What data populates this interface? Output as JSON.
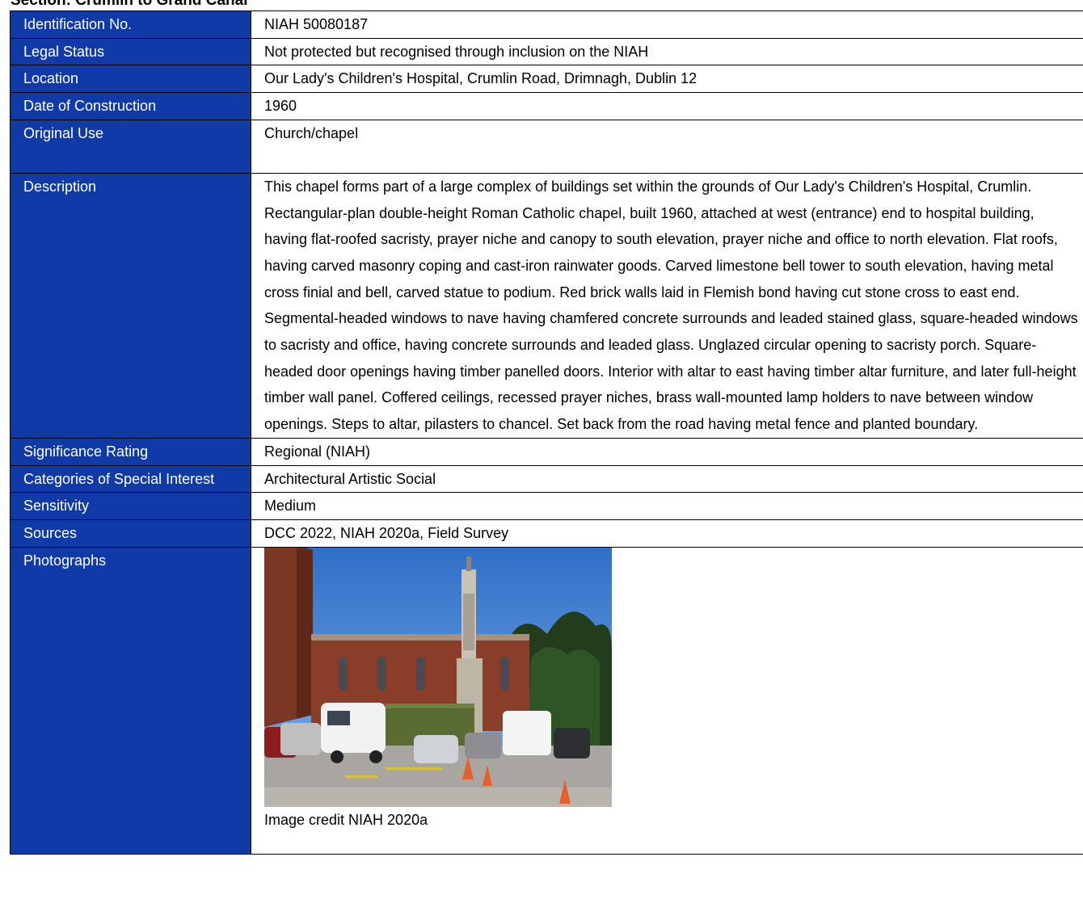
{
  "section": {
    "heading": "Section: Crumlin to Grand Canal"
  },
  "record": {
    "identification_label": "Identification No.",
    "identification_value": "NIAH 50080187",
    "legal_status_label": "Legal Status",
    "legal_status_value": "Not protected but recognised through inclusion on the NIAH",
    "location_label": "Location",
    "location_value": "Our Lady's Children's Hospital, Crumlin Road, Drimnagh, Dublin 12",
    "date_label": "Date of Construction",
    "date_value": "1960",
    "original_use_label": "Original Use",
    "original_use_value": "Church/chapel",
    "description_label": "Description",
    "description_value": "This chapel forms part of a large complex of buildings set within the grounds of Our Lady's Children's Hospital, Crumlin. Rectangular-plan double-height Roman Catholic chapel, built 1960, attached at west (entrance) end to hospital building, having flat-roofed sacristy, prayer niche and canopy to south elevation, prayer niche and office to north elevation. Flat roofs, having carved masonry coping and cast-iron rainwater goods. Carved limestone bell tower to south elevation, having metal cross finial and bell, carved statue to podium. Red brick walls laid in Flemish bond having cut stone cross to east end. Segmental-headed windows to nave having chamfered concrete surrounds and leaded stained glass, square-headed windows to sacristy and office, having concrete surrounds and leaded glass. Unglazed circular opening to sacristy porch. Square-headed door openings having timber panelled doors. Interior with altar to east having timber altar furniture, and later full-height timber wall panel. Coffered ceilings, recessed prayer niches, brass wall-mounted lamp holders to nave between window openings. Steps to altar, pilasters to chancel. Set back from the road having metal fence and planted boundary.",
    "significance_label": "Significance Rating",
    "significance_value": "Regional (NIAH)",
    "categories_label": "Categories of Special Interest",
    "categories_value": "Architectural Artistic Social",
    "sensitivity_label": "Sensitivity",
    "sensitivity_value": "Medium",
    "sources_label": "Sources",
    "sources_value": "DCC 2022, NIAH 2020a, Field Survey",
    "photographs_label": "Photographs",
    "photo_credit": "Image credit NIAH 2020a"
  },
  "colors": {
    "label_background": "#0f3aa8",
    "label_text": "#ffffff",
    "border": "#000000"
  }
}
